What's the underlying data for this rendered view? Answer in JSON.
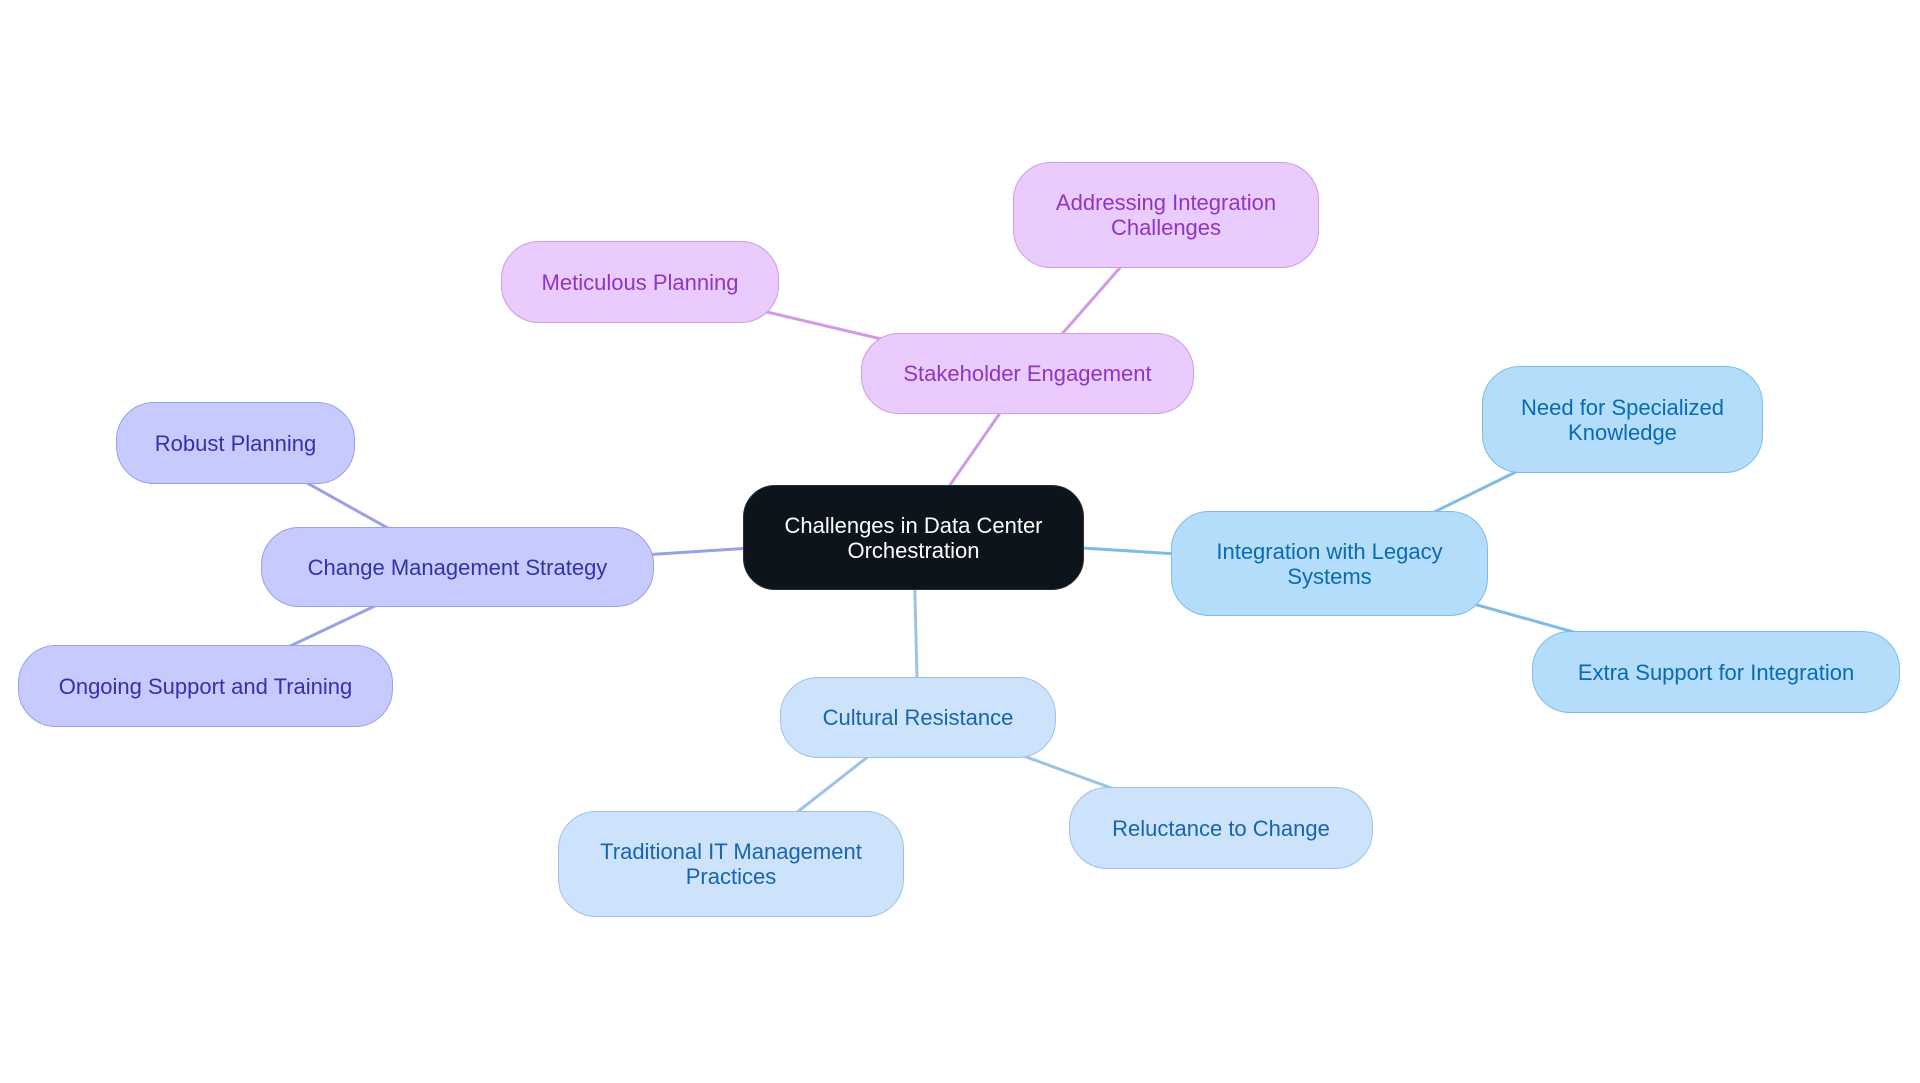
{
  "diagram": {
    "type": "mindmap",
    "root": {
      "id": "root",
      "label": "Challenges in Data Center\nOrchestration"
    },
    "colors": {
      "root_fill": "#0d141b",
      "stakeholder_branch": "#cf9ae8",
      "change_branch": "#9aa0e6",
      "integration_branch": "#7dbce8",
      "cultural_branch": "#9cc2ea"
    },
    "branches": [
      {
        "id": "stakeholder",
        "label": "Stakeholder Engagement",
        "theme": "pink",
        "children": [
          {
            "id": "meticulous",
            "label": "Meticulous Planning"
          },
          {
            "id": "addressing",
            "label": "Addressing Integration\nChallenges"
          }
        ]
      },
      {
        "id": "change",
        "label": "Change Management Strategy",
        "theme": "indigo",
        "children": [
          {
            "id": "robust",
            "label": "Robust Planning"
          },
          {
            "id": "ongoing",
            "label": "Ongoing Support and Training"
          }
        ]
      },
      {
        "id": "integration",
        "label": "Integration with Legacy\nSystems",
        "theme": "sky",
        "children": [
          {
            "id": "need",
            "label": "Need for Specialized\nKnowledge"
          },
          {
            "id": "extra",
            "label": "Extra Support for Integration"
          }
        ]
      },
      {
        "id": "cultural",
        "label": "Cultural Resistance",
        "theme": "light",
        "children": [
          {
            "id": "traditional",
            "label": "Traditional IT Management\nPractices"
          },
          {
            "id": "reluctance",
            "label": "Reluctance to Change"
          }
        ]
      }
    ]
  }
}
